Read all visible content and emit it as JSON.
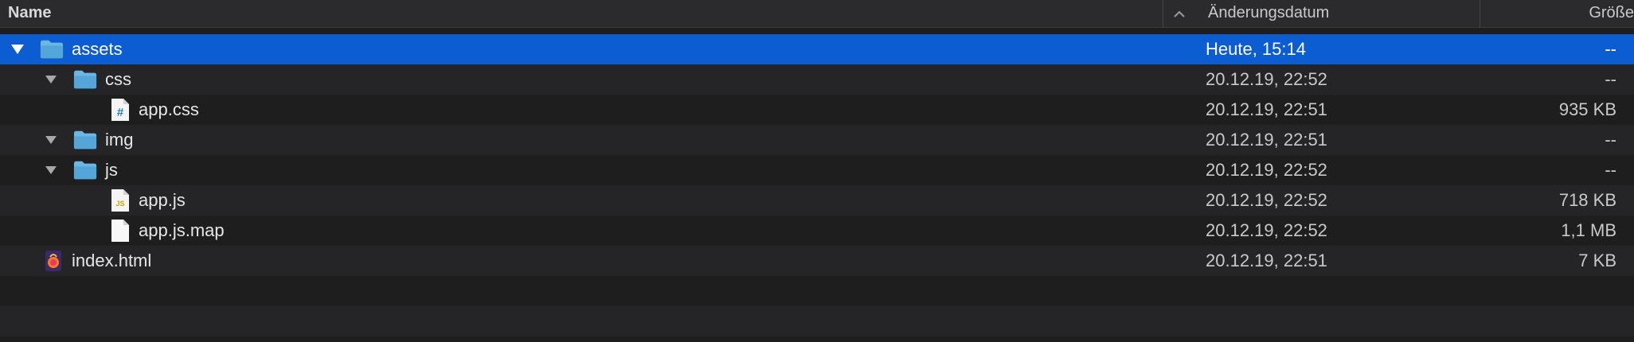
{
  "header": {
    "name_label": "Name",
    "date_label": "Änderungsdatum",
    "size_label": "Größe"
  },
  "rows": [
    {
      "name": "assets",
      "date": "Heute, 15:14",
      "size": "--",
      "icon": "folder-icon"
    },
    {
      "name": "css",
      "date": "20.12.19, 22:52",
      "size": "--",
      "icon": "folder-icon"
    },
    {
      "name": "app.css",
      "date": "20.12.19, 22:51",
      "size": "935 KB",
      "icon": "css-file-icon"
    },
    {
      "name": "img",
      "date": "20.12.19, 22:51",
      "size": "--",
      "icon": "folder-icon"
    },
    {
      "name": "js",
      "date": "20.12.19, 22:52",
      "size": "--",
      "icon": "folder-icon"
    },
    {
      "name": "app.js",
      "date": "20.12.19, 22:52",
      "size": "718 KB",
      "icon": "js-file-icon"
    },
    {
      "name": "app.js.map",
      "date": "20.12.19, 22:52",
      "size": "1,1 MB",
      "icon": "file-icon"
    },
    {
      "name": "index.html",
      "date": "20.12.19, 22:51",
      "size": "7 KB",
      "icon": "html-file-icon"
    }
  ],
  "icons": {
    "css_glyph": "#",
    "js_glyph": "JS"
  },
  "colors": {
    "selection": "#0c5dd1",
    "folder": "#5aa9d6",
    "background": "#1e1e1f"
  }
}
